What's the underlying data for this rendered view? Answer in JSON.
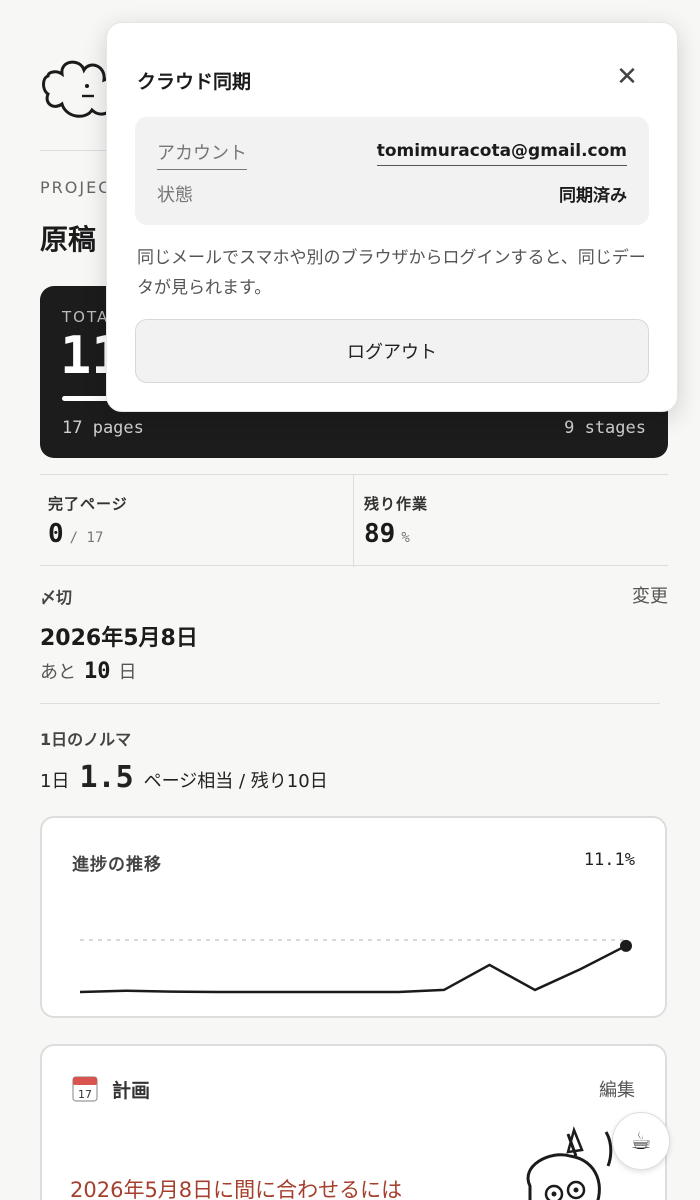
{
  "project": {
    "section_label": "PROJECT",
    "title": "原稿"
  },
  "total": {
    "label": "TOTAL",
    "value": "11",
    "pages": "17 pages",
    "stages": "9 stages"
  },
  "stats": {
    "completed_label": "完了ページ",
    "completed_value": "0",
    "completed_unit": "/ 17",
    "remaining_label": "残り作業",
    "remaining_value": "89",
    "remaining_unit": "%"
  },
  "deadline": {
    "label": "〆切",
    "change_link": "変更",
    "date": "2026年5月8日",
    "remain_prefix": "あと",
    "remain_days": "10",
    "remain_suffix": "日"
  },
  "norma": {
    "label": "1日のノルマ",
    "prefix": "1日",
    "value": "1.5",
    "suffix": "ページ相当 / 残り10日"
  },
  "progress_chart": {
    "title": "進捗の推移",
    "percent": "11.1%"
  },
  "chart_data": {
    "type": "line",
    "title": "進捗の推移",
    "series": [
      {
        "values": [
          0,
          0.3,
          0.1,
          0,
          0,
          0,
          0,
          0,
          0.5,
          6.5,
          0.5,
          5.5,
          11.1
        ]
      }
    ],
    "ylim": [
      0,
      100
    ],
    "target_line": true,
    "grid": false
  },
  "plan": {
    "icon": "calendar-icon",
    "calendar_day": "17",
    "title": "計画",
    "edit_link": "編集",
    "headline": "2026年5月8日に間に合わせるには"
  },
  "fab": {
    "icon": "coffee-icon"
  },
  "modal": {
    "title": "クラウド同期",
    "close_icon": "close-icon",
    "account_label": "アカウント",
    "account_value": "tomimuracota@gmail.com",
    "status_label": "状態",
    "status_value": "同期済み",
    "description": "同じメールでスマホや別のブラウザからログインすると、同じデータが見られます。",
    "logout_label": "ログアウト"
  }
}
